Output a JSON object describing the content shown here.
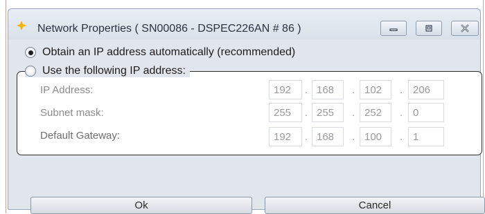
{
  "window": {
    "title": "Network Properties ( SN00086 - DSPEC226AN # 86 )",
    "minimize_icon": "minimize-icon",
    "maximize_icon": "maximize-icon",
    "close_icon": "close-icon"
  },
  "options": {
    "auto": {
      "label": "Obtain an IP address automatically (recommended)",
      "selected": true
    },
    "manual": {
      "label": "Use the following IP address:",
      "selected": false
    }
  },
  "fields": [
    {
      "label": "IP Address:",
      "octets": [
        "192",
        "168",
        "102",
        "206"
      ]
    },
    {
      "label": "Subnet mask:",
      "octets": [
        "255",
        "255",
        "252",
        "0"
      ]
    },
    {
      "label": "Default Gateway:",
      "octets": [
        "192",
        "168",
        "100",
        "1"
      ]
    }
  ],
  "buttons": {
    "ok": "Ok",
    "cancel": "Cancel"
  },
  "colors": {
    "accent_icon": "#f5b400",
    "window_bg": "#e1e6ec",
    "disabled_text": "#9a9a9a"
  }
}
